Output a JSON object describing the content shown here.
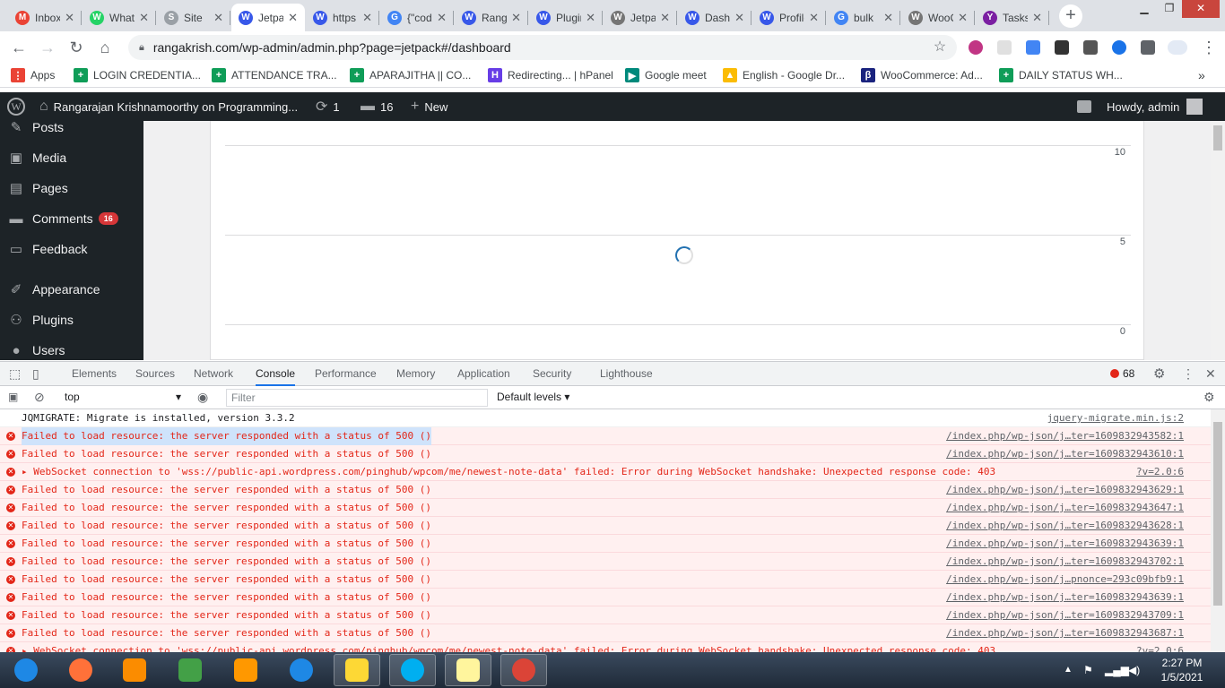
{
  "browser": {
    "tabs": [
      {
        "title": "Inbox",
        "icon": "gmail-icon",
        "color": "#ea4335",
        "glyph": "M"
      },
      {
        "title": "WhatsApp",
        "icon": "whatsapp-icon",
        "color": "#25d366",
        "glyph": "W"
      },
      {
        "title": "Site",
        "icon": "site-icon",
        "color": "#9aa0a6",
        "glyph": "S"
      },
      {
        "title": "Jetpack",
        "icon": "wordpress-icon",
        "color": "#3858e9",
        "glyph": "W"
      },
      {
        "title": "https",
        "icon": "wordpress-icon",
        "color": "#3858e9",
        "glyph": "W"
      },
      {
        "title": "{\"code\"",
        "icon": "google-icon",
        "color": "#4285f4",
        "glyph": "G"
      },
      {
        "title": "Rangarajan",
        "icon": "wordpress-icon",
        "color": "#3858e9",
        "glyph": "W"
      },
      {
        "title": "Plugins",
        "icon": "wordpress-icon",
        "color": "#3858e9",
        "glyph": "W"
      },
      {
        "title": "Jetpack",
        "icon": "wordpress-icon",
        "color": "#757575",
        "glyph": "W"
      },
      {
        "title": "Dashboard",
        "icon": "wordpress-icon",
        "color": "#3858e9",
        "glyph": "W"
      },
      {
        "title": "Profile",
        "icon": "wordpress-icon",
        "color": "#3858e9",
        "glyph": "W"
      },
      {
        "title": "bulk",
        "icon": "google-icon",
        "color": "#4285f4",
        "glyph": "G"
      },
      {
        "title": "WooCommerce",
        "icon": "wordpress-icon",
        "color": "#757575",
        "glyph": "W"
      },
      {
        "title": "Tasks",
        "icon": "yahoo-icon",
        "color": "#7b1fa2",
        "glyph": "Y"
      }
    ],
    "url": "rangakrish.com/wp-admin/admin.php?page=jetpack#/dashboard",
    "bookmarks": [
      {
        "label": "Apps",
        "color": "#ea4335",
        "glyph": "⋮"
      },
      {
        "label": "LOGIN CREDENTIA...",
        "color": "#0f9d58",
        "glyph": "+"
      },
      {
        "label": "ATTENDANCE TRA...",
        "color": "#0f9d58",
        "glyph": "+"
      },
      {
        "label": "APARAJITHA || CO...",
        "color": "#0f9d58",
        "glyph": "+"
      },
      {
        "label": "Redirecting... | hPanel",
        "color": "#673de6",
        "glyph": "H"
      },
      {
        "label": "Google meet",
        "color": "#00897b",
        "glyph": "▶"
      },
      {
        "label": "English - Google Dr...",
        "color": "#fbbc04",
        "glyph": "▲"
      },
      {
        "label": "WooCommerce: Ad...",
        "color": "#1a237e",
        "glyph": "β"
      },
      {
        "label": "DAILY STATUS WH...",
        "color": "#0f9d58",
        "glyph": "+"
      }
    ]
  },
  "adminbar": {
    "site_name": "Rangarajan Krishnamoorthy on Programming...",
    "updates": "1",
    "comments": "16",
    "new_label": "New",
    "howdy": "Howdy, admin"
  },
  "sidebar": {
    "items": [
      {
        "label": "Posts",
        "icon": "pin-icon",
        "glyph": "✎"
      },
      {
        "label": "Media",
        "icon": "media-icon",
        "glyph": "▣"
      },
      {
        "label": "Pages",
        "icon": "pages-icon",
        "glyph": "▤"
      },
      {
        "label": "Comments",
        "icon": "comments-icon",
        "glyph": "▬",
        "badge": "16"
      },
      {
        "label": "Feedback",
        "icon": "feedback-icon",
        "glyph": "▭"
      },
      {
        "label": "Appearance",
        "icon": "appearance-icon",
        "glyph": "✐"
      },
      {
        "label": "Plugins",
        "icon": "plugins-icon",
        "glyph": "⚇"
      },
      {
        "label": "Users",
        "icon": "users-icon",
        "glyph": "●"
      }
    ]
  },
  "chart": {
    "y_ticks": [
      "10",
      "5",
      "0"
    ]
  },
  "devtools": {
    "tabs": [
      "Elements",
      "Sources",
      "Network",
      "Console",
      "Performance",
      "Memory",
      "Application",
      "Security",
      "Lighthouse"
    ],
    "active_tab": "Console",
    "error_count": "68",
    "context": "top",
    "filter_placeholder": "Filter",
    "levels": "Default levels ▾",
    "messages": [
      {
        "type": "info",
        "text": "JQMIGRATE: Migrate is installed, version 3.3.2",
        "source": "jquery-migrate.min.js:2"
      },
      {
        "type": "error",
        "text": "Failed to load resource: the server responded with a status of 500 ()",
        "source": "/index.php/wp-json/j…ter=1609832943582:1",
        "selected": true
      },
      {
        "type": "error",
        "text": "Failed to load resource: the server responded with a status of 500 ()",
        "source": "/index.php/wp-json/j…ter=1609832943610:1"
      },
      {
        "type": "error",
        "text": "▸ WebSocket connection to 'wss://public-api.wordpress.com/pinghub/wpcom/me/newest-note-data' failed: Error during WebSocket handshake: Unexpected response code: 403",
        "source": "?v=2.0:6"
      },
      {
        "type": "error",
        "text": "Failed to load resource: the server responded with a status of 500 ()",
        "source": "/index.php/wp-json/j…ter=1609832943629:1"
      },
      {
        "type": "error",
        "text": "Failed to load resource: the server responded with a status of 500 ()",
        "source": "/index.php/wp-json/j…ter=1609832943647:1"
      },
      {
        "type": "error",
        "text": "Failed to load resource: the server responded with a status of 500 ()",
        "source": "/index.php/wp-json/j…ter=1609832943628:1"
      },
      {
        "type": "error",
        "text": "Failed to load resource: the server responded with a status of 500 ()",
        "source": "/index.php/wp-json/j…ter=1609832943639:1"
      },
      {
        "type": "error",
        "text": "Failed to load resource: the server responded with a status of 500 ()",
        "source": "/index.php/wp-json/j…ter=1609832943702:1"
      },
      {
        "type": "error",
        "text": "Failed to load resource: the server responded with a status of 500 ()",
        "source": "/index.php/wp-json/j…pnonce=293c09bfb9:1"
      },
      {
        "type": "error",
        "text": "Failed to load resource: the server responded with a status of 500 ()",
        "source": "/index.php/wp-json/j…ter=1609832943639:1"
      },
      {
        "type": "error",
        "text": "Failed to load resource: the server responded with a status of 500 ()",
        "source": "/index.php/wp-json/j…ter=1609832943709:1"
      },
      {
        "type": "error",
        "text": "Failed to load resource: the server responded with a status of 500 ()",
        "source": "/index.php/wp-json/j…ter=1609832943687:1"
      },
      {
        "type": "error",
        "text": "▸ WebSocket connection to 'wss://public-api.wordpress.com/pinghub/wpcom/me/newest-note-data' failed: Error during WebSocket handshake: Unexpected response code: 403",
        "source": "?v=2.0:6"
      }
    ]
  },
  "taskbar": {
    "apps": [
      {
        "icon": "start-orb-icon",
        "color": "#1e88e5"
      },
      {
        "icon": "firefox-icon",
        "color": "#ff7139"
      },
      {
        "icon": "media-player-icon",
        "color": "#fb8c00"
      },
      {
        "icon": "app-diamond-icon",
        "color": "#43a047"
      },
      {
        "icon": "sublime-text-icon",
        "color": "#ff9800"
      },
      {
        "icon": "internet-explorer-icon",
        "color": "#1e88e5"
      },
      {
        "icon": "file-explorer-icon",
        "color": "#fdd835"
      },
      {
        "icon": "skype-icon",
        "color": "#00aff0"
      },
      {
        "icon": "sticky-notes-icon",
        "color": "#fff59d"
      },
      {
        "icon": "chrome-icon",
        "color": "#db4437"
      }
    ],
    "time": "2:27 PM",
    "date": "1/5/2021"
  }
}
